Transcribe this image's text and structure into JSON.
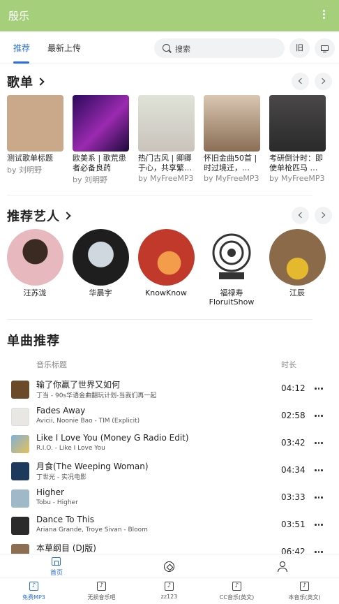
{
  "app": {
    "title": "殷乐"
  },
  "tabs": [
    {
      "label": "推荐",
      "active": true
    },
    {
      "label": "最新上传",
      "active": false
    }
  ],
  "search": {
    "placeholder": "搜索"
  },
  "header_buttons": {
    "old": "旧",
    "tv_icon": "tv-icon"
  },
  "playlists": {
    "title": "歌单",
    "items": [
      {
        "name": "测试歌单标题",
        "by": "by 刘明野",
        "color": "#c9a98a"
      },
      {
        "name": "欧美系 | 歌荒患者必备良药",
        "by": "by 刘明野",
        "color": "#4a1a8a"
      },
      {
        "name": "热门古风 | 卿卿于心，共享繁…",
        "by": "by MyFreeMP3",
        "color": "#d8d4cf"
      },
      {
        "name": "怀旧金曲50首 | 时过境迁，…",
        "by": "by MyFreeMP3",
        "color": "#a58f78"
      },
      {
        "name": "考研倒计时：即使单枪匹马 …",
        "by": "by MyFreeMP3",
        "color": "#3b3a3a"
      }
    ]
  },
  "artists": {
    "title": "推荐艺人",
    "items": [
      {
        "name": "汪苏泷",
        "color": "#e7b9bf"
      },
      {
        "name": "华晨宇",
        "color": "#1e1e1e"
      },
      {
        "name": "KnowKnow",
        "color": "#c0392b"
      },
      {
        "name": "福禄寿 FloruitShow",
        "color": "#ffffff"
      },
      {
        "name": "江辰",
        "color": "#8a6a48"
      }
    ]
  },
  "songs": {
    "title": "单曲推荐",
    "col_title": "音乐标题",
    "col_duration": "时长",
    "items": [
      {
        "title": "输了你赢了世界又如何",
        "sub": "丁当 - 90s华语金曲翻玩计划-当我们再一起",
        "duration": "04:12",
        "color": "#6b4a2a"
      },
      {
        "title": "Fades Away",
        "sub": "Avicii, Noonie Bao - TIM (Explicit)",
        "duration": "02:58",
        "color": "#e9e7e4"
      },
      {
        "title": "Like I Love You (Money G Radio Edit)",
        "sub": "R.I.O. - Like I Love You",
        "duration": "03:42",
        "color": "#7fb0d8"
      },
      {
        "title": "月食(The Weeping Woman)",
        "sub": "丁世光 - 实况电影",
        "duration": "04:34",
        "color": "#1d3a5c"
      },
      {
        "title": "Higher",
        "sub": "Tobu - Higher",
        "duration": "03:33",
        "color": "#9fb9c9"
      },
      {
        "title": "Dance To This",
        "sub": "Ariana Grande, Troye Sivan - Bloom",
        "duration": "03:51",
        "color": "#2b2b2b"
      },
      {
        "title": "本草纲目 (DJ版)",
        "sub": "",
        "duration": "06:42",
        "color": "#8d6e52"
      }
    ]
  },
  "bottom_nav": {
    "home": "首页"
  },
  "sources": [
    {
      "label": "免费MP3",
      "active": true
    },
    {
      "label": "无损音乐吧",
      "active": false
    },
    {
      "label": "zz123",
      "active": false
    },
    {
      "label": "CC音乐(英文)",
      "active": false
    },
    {
      "label": "本音乐(英文)",
      "active": false
    }
  ],
  "colors": {
    "appbar": "#a6cf7c",
    "accent": "#2a6fe0"
  }
}
